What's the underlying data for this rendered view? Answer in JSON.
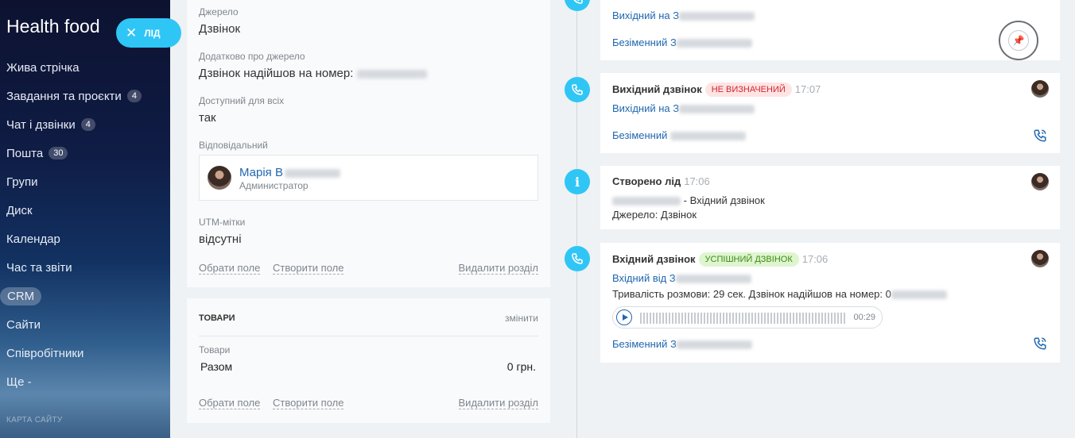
{
  "sidebar": {
    "title": "Health food",
    "items": [
      {
        "label": "Жива стрічка",
        "badge": ""
      },
      {
        "label": "Завдання та проєкти",
        "badge": "4"
      },
      {
        "label": "Чат і дзвінки",
        "badge": "4"
      },
      {
        "label": "Пошта",
        "badge": "30"
      },
      {
        "label": "Групи",
        "badge": ""
      },
      {
        "label": "Диск",
        "badge": ""
      },
      {
        "label": "Календар",
        "badge": ""
      },
      {
        "label": "Час та звіти",
        "badge": ""
      },
      {
        "label": "CRM",
        "badge": ""
      },
      {
        "label": "Сайти",
        "badge": ""
      },
      {
        "label": "Співробітники",
        "badge": ""
      },
      {
        "label": "Ще -",
        "badge": ""
      }
    ],
    "sitemap": "КАРТА САЙТУ"
  },
  "lead_button": {
    "close": "✕",
    "label": "ЛІД"
  },
  "details": {
    "source_label": "Джерело",
    "source_value": "Дзвінок",
    "extra_label": "Додатково про джерело",
    "extra_value": "Дзвінок надійшов на номер:",
    "public_label": "Доступний для всіх",
    "public_value": "так",
    "responsible_label": "Відповідальний",
    "responsible_name": "Марія В",
    "responsible_role": "Администратор",
    "utm_label": "UTM-мітки",
    "utm_value": "відсутні",
    "choose_field": "Обрати поле",
    "create_field": "Створити поле",
    "delete_section": "Видалити розділ"
  },
  "goods": {
    "title": "ТОВАРИ",
    "edit": "змінити",
    "label": "Товари",
    "total_label": "Разом",
    "total_value": "0 грн.",
    "choose_field": "Обрати поле",
    "create_field": "Створити поле",
    "delete_section": "Видалити розділ"
  },
  "timeline": {
    "item0": {
      "line1": "Вихідний на З",
      "line2": "Безіменний З"
    },
    "item1": {
      "title": "Вихідний дзвінок",
      "tag": "НЕ ВИЗНАЧЕНИЙ",
      "time": "17:07",
      "line1": "Вихідний на З",
      "line2": "Безіменний"
    },
    "item2": {
      "title": "Створено лід",
      "time": "17:06",
      "line1_suffix": "- Вхідний дзвінок",
      "line2": "Джерело: Дзвінок"
    },
    "item3": {
      "title": "Вхідний дзвінок",
      "tag": "УСПІШНИЙ ДЗВІНОК",
      "time": "17:06",
      "line1": "Вхідний від З",
      "line2": "Тривалість розмови: 29 сек. Дзвінок надійшов на номер: 0",
      "duration": "00:29",
      "line3": "Безіменний З"
    }
  },
  "icons": {
    "phone": "phone-icon",
    "info": "info-icon",
    "pin": "pin-icon",
    "play": "play-icon",
    "close": "close-icon"
  },
  "colors": {
    "accent": "#2fc6f6",
    "link": "#2067b0",
    "tag_red": "#d0262f",
    "tag_green": "#3d8a14"
  }
}
